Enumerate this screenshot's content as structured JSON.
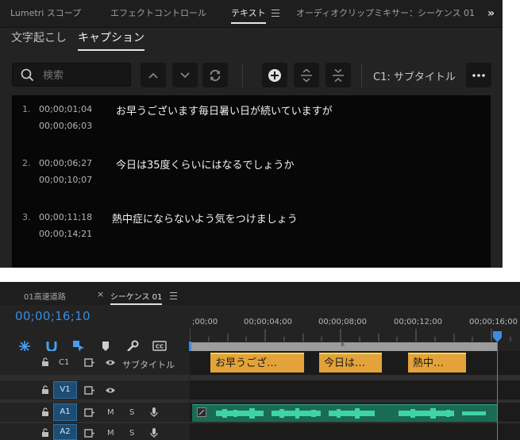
{
  "top_panel": {
    "tabs": [
      "Lumetri スコープ",
      "エフェクトコントロール",
      "テキスト",
      "オーディオクリップミキサー：シーケンス 01"
    ],
    "more": "»",
    "subtabs": [
      "文字起こし",
      "キャプション"
    ],
    "search_placeholder": "検索",
    "track_label": "C1: サブタイトル",
    "captions": [
      {
        "num": "1.",
        "in": "00;00;01;04",
        "out": "00;00;06;03",
        "text": "お早うございます毎日暑い日が続いていますが"
      },
      {
        "num": "2.",
        "in": "00;00;06;27",
        "out": "00;00;10;07",
        "text": "今日は35度くらいにはなるでしょうか"
      },
      {
        "num": "3.",
        "in": "00;00;11;18",
        "out": "00;00;14;21",
        "text": "熱中症にならないよう気をつけましょう"
      }
    ]
  },
  "timeline": {
    "tabs": [
      "01高速道路",
      "シーケンス 01"
    ],
    "tab_close": "×",
    "timecode": "00;00;16;10",
    "ruler": [
      ";00;00",
      "00;00;04;00",
      "00;00;08;00",
      "00;00;12;00",
      "00;00;16;00"
    ],
    "work_area_marker": "III",
    "tracks": [
      {
        "id": "C1",
        "label": "サブタイトル"
      },
      {
        "id": "V1",
        "label": ""
      },
      {
        "id": "A1",
        "label": ""
      },
      {
        "id": "A2",
        "label": ""
      }
    ],
    "track_ctl_m": "M",
    "track_ctl_s": "S",
    "clips": [
      "お早うござ…",
      "今日は…",
      "熱中…"
    ],
    "colors": {
      "accent": "#3b8be0",
      "caption_clip": "#e3a33a",
      "audio_clip": "#1f8a6c",
      "track_active": "#1e4d73"
    }
  }
}
